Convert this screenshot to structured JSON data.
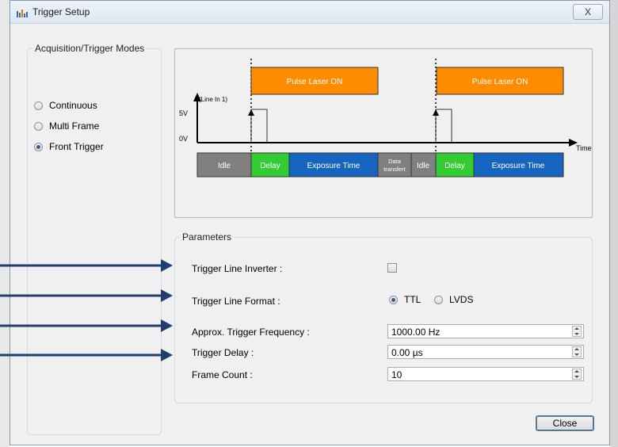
{
  "window": {
    "title": "Trigger Setup",
    "close_glyph": "X"
  },
  "modes": {
    "title": "Acquisition/Trigger Modes",
    "options": [
      {
        "label": "Continuous",
        "checked": false
      },
      {
        "label": "Multi Frame",
        "checked": false
      },
      {
        "label": "Front Trigger",
        "checked": true
      }
    ]
  },
  "diagram": {
    "pulse_label_1": "Pulse Laser ON",
    "pulse_label_2": "Pulse Laser ON",
    "v5": "5V",
    "line_in": "(Line In 1)",
    "v0": "0V",
    "time": "Time",
    "timeline": [
      "Idle",
      "Delay",
      "Exposure Time",
      "Data",
      "transfert",
      "Idle",
      "Delay",
      "Exposure Time"
    ],
    "colors": {
      "pulse": "#ff8c00",
      "idle": "#808080",
      "delay": "#33cc33",
      "exposure": "#1565c0"
    }
  },
  "parameters": {
    "title": "Parameters",
    "inverter_label": "Trigger Line Inverter :",
    "inverter_checked": false,
    "format_label": "Trigger Line Format :",
    "format_options": [
      "TTL",
      "LVDS"
    ],
    "format_selected": "TTL",
    "frequency_label": "Approx. Trigger Frequency :",
    "frequency_value": "1000.00 Hz",
    "delay_label": "Trigger Delay :",
    "delay_value": "0.00 µs",
    "count_label": "Frame Count :",
    "count_value": "10"
  },
  "footer": {
    "close_label": "Close"
  }
}
